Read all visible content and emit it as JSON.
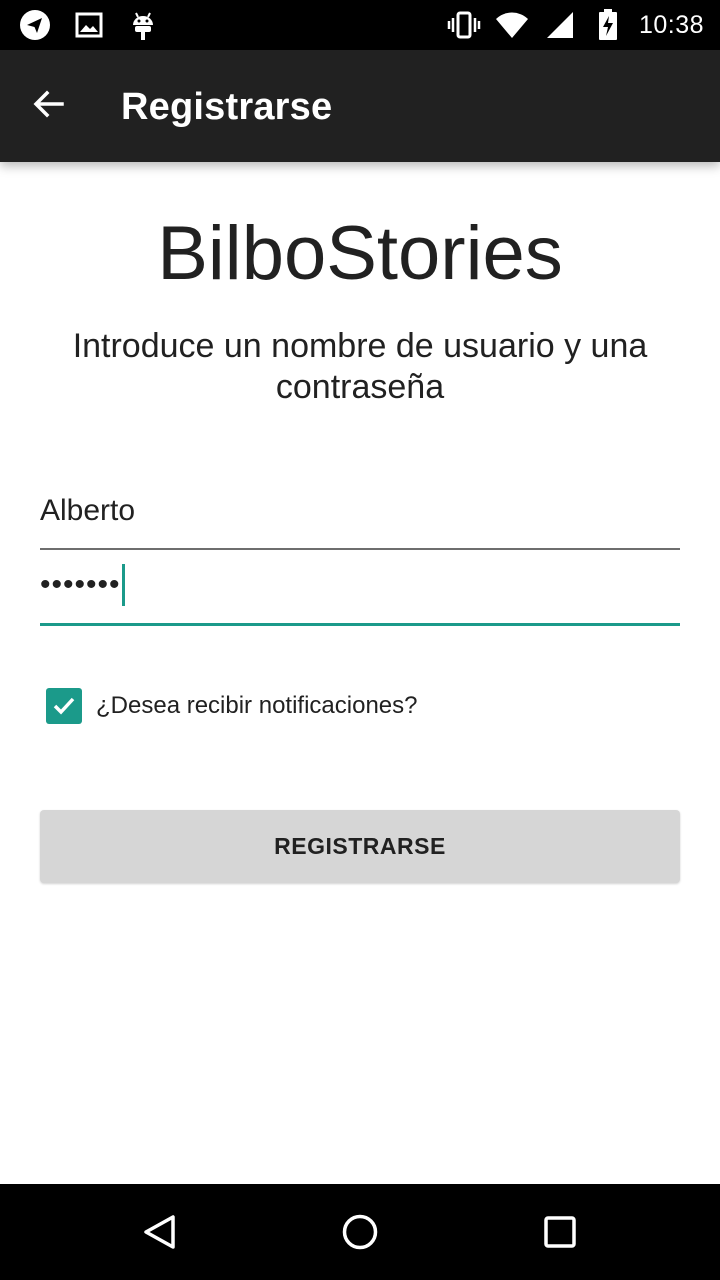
{
  "status_bar": {
    "time": "10:38",
    "left_icons": [
      "telegram-icon",
      "image-icon",
      "android-icon"
    ],
    "right_icons": [
      "vibrate-icon",
      "wifi-icon",
      "signal-icon",
      "battery-charging-icon"
    ]
  },
  "app_bar": {
    "back_icon": "arrow-back-icon",
    "title": "Registrarse"
  },
  "main": {
    "brand": "BilboStories",
    "subtitle": "Introduce un nombre de usuario y una contraseña",
    "username_value": "Alberto",
    "password_value": "•••••••",
    "notifications_label": "¿Desea recibir notificaciones?",
    "notifications_checked": true,
    "register_button": "REGISTRARSE"
  },
  "nav_bar": {
    "icons": [
      "nav-back-icon",
      "nav-home-icon",
      "nav-recents-icon"
    ]
  },
  "colors": {
    "accent": "#1b9a8a",
    "app_bar": "#212121",
    "button": "#d6d6d6"
  }
}
